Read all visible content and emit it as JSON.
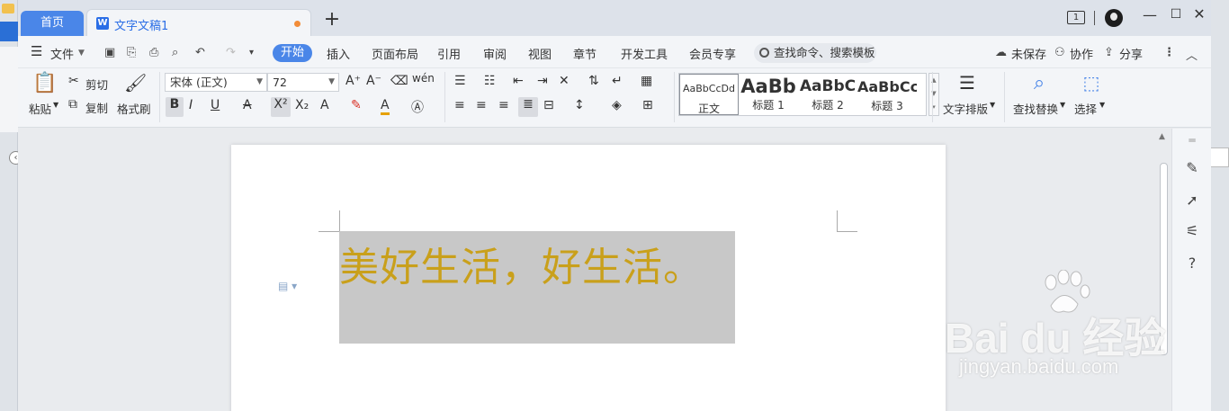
{
  "titlebar": {
    "home_tab": "首页",
    "doc_tab": "文字文稿1",
    "doc_icon": "W",
    "new_tab": "+",
    "window_count": "1",
    "minimize": "—",
    "maximize": "☐",
    "close": "✕"
  },
  "menubar": {
    "file": "文件",
    "items": [
      "开始",
      "插入",
      "页面布局",
      "引用",
      "审阅",
      "视图",
      "章节",
      "开发工具",
      "会员专享"
    ],
    "search_placeholder": "查找命令、搜索模板",
    "unsaved": "未保存",
    "collaborate": "协作",
    "share": "分享"
  },
  "ribbon": {
    "paste": "粘贴",
    "cut": "剪切",
    "copy": "复制",
    "format_painter": "格式刷",
    "font_name": "宋体 (正文)",
    "font_size": "72",
    "styles": [
      {
        "sample": "AaBbCcDd",
        "label": "正文"
      },
      {
        "sample": "AaBb",
        "label": "标题 1"
      },
      {
        "sample": "AaBbC",
        "label": "标题 2"
      },
      {
        "sample": "AaBbCc",
        "label": "标题 3"
      }
    ],
    "text_layout": "文字排版",
    "find_replace": "查找替换",
    "select": "选择"
  },
  "document": {
    "text": "美好生活，好生活。",
    "text_color": "#c9a01b",
    "selection_color": "#c8c8c8"
  },
  "watermark": {
    "brand": "Bai du 经验",
    "url": "jingyan.baidu.com"
  },
  "colors": {
    "accent": "#4a86e8"
  }
}
